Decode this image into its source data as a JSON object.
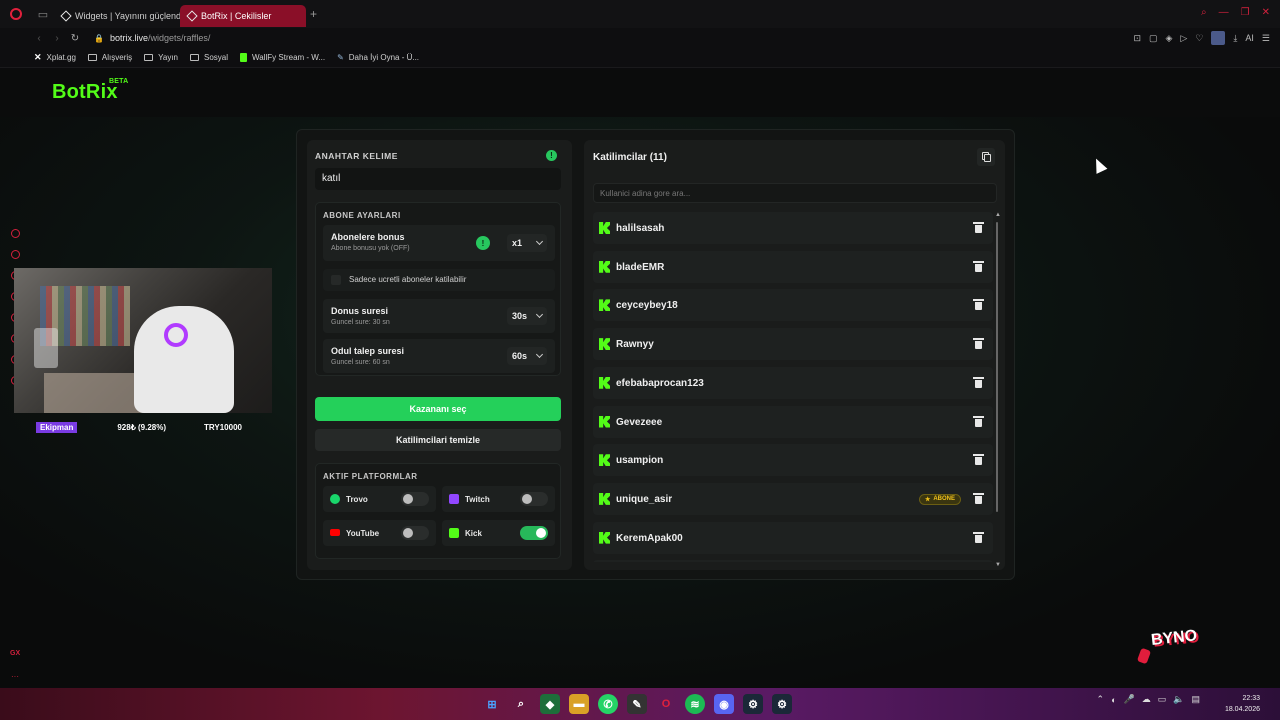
{
  "browser": {
    "tabs": [
      {
        "title": "Widgets | Yayınını güçlendir",
        "active": false
      },
      {
        "title": "BotRix | Cekilisler",
        "active": true
      }
    ],
    "new_tab": "+",
    "address": {
      "domain": "botrix.live",
      "path": "/widgets/raffles/"
    },
    "bookmarks": [
      {
        "label": "Xplat.gg",
        "icon": "x-icon"
      },
      {
        "label": "Alışveriş",
        "icon": "folder-icon"
      },
      {
        "label": "Yayın",
        "icon": "folder-icon"
      },
      {
        "label": "Sosyal",
        "icon": "folder-icon"
      },
      {
        "label": "WallFy Stream - W...",
        "icon": "kick-icon"
      },
      {
        "label": "Daha İyi Oyna - Ü...",
        "icon": "pen-icon"
      }
    ],
    "ai_label": "AI"
  },
  "brand": {
    "name": "BotRix",
    "badge": "BETA",
    "color": "#53fc18"
  },
  "webcam": {
    "name": "Ekipman",
    "money": "928₺ (9.28%)",
    "goal": "TRY10000"
  },
  "keyword": {
    "title": "ANAHTAR KELIME",
    "value": "katıl"
  },
  "subscriber_settings": {
    "title": "ABONE AYARLARI",
    "bonus": {
      "label": "Abonelere bonus",
      "sub": "Abone bonusu yok (OFF)",
      "value": "x1"
    },
    "paid_only": {
      "label": "Sadece ucretli aboneler katilabilir"
    },
    "bonus_time": {
      "label": "Donus suresi",
      "sub": "Guncel sure: 30 sn",
      "value": "30s"
    },
    "claim_time": {
      "label": "Odul talep suresi",
      "sub": "Guncel sure: 60 sn",
      "value": "60s"
    }
  },
  "actions": {
    "pick_winner": "Kazananı seç",
    "clear_participants": "Katilimcilari temizle"
  },
  "platforms": {
    "title": "AKTIF PLATFORMLAR",
    "items": [
      {
        "name": "Trovo",
        "enabled": false,
        "color": "#19d66b"
      },
      {
        "name": "Twitch",
        "enabled": false,
        "color": "#9146ff"
      },
      {
        "name": "YouTube",
        "enabled": false,
        "color": "#ff0000"
      },
      {
        "name": "Kick",
        "enabled": true,
        "color": "#53fc18"
      }
    ]
  },
  "participants": {
    "title": "Katilimcilar (11)",
    "search_placeholder": "Kullanici adina gore ara...",
    "list": [
      {
        "name": "halilsasah",
        "badge": ""
      },
      {
        "name": "bladeEMR",
        "badge": ""
      },
      {
        "name": "ceyceybey18",
        "badge": ""
      },
      {
        "name": "Rawnyy",
        "badge": ""
      },
      {
        "name": "efebabaprocan123",
        "badge": ""
      },
      {
        "name": "Gevezeee",
        "badge": ""
      },
      {
        "name": "usampion",
        "badge": ""
      },
      {
        "name": "unique_asir",
        "badge": "ABONE"
      },
      {
        "name": "KeremApak00",
        "badge": ""
      }
    ]
  },
  "overlay": {
    "byno": "BYNO"
  },
  "taskbar": {
    "time": "22:33",
    "date": "18.04.2026"
  }
}
